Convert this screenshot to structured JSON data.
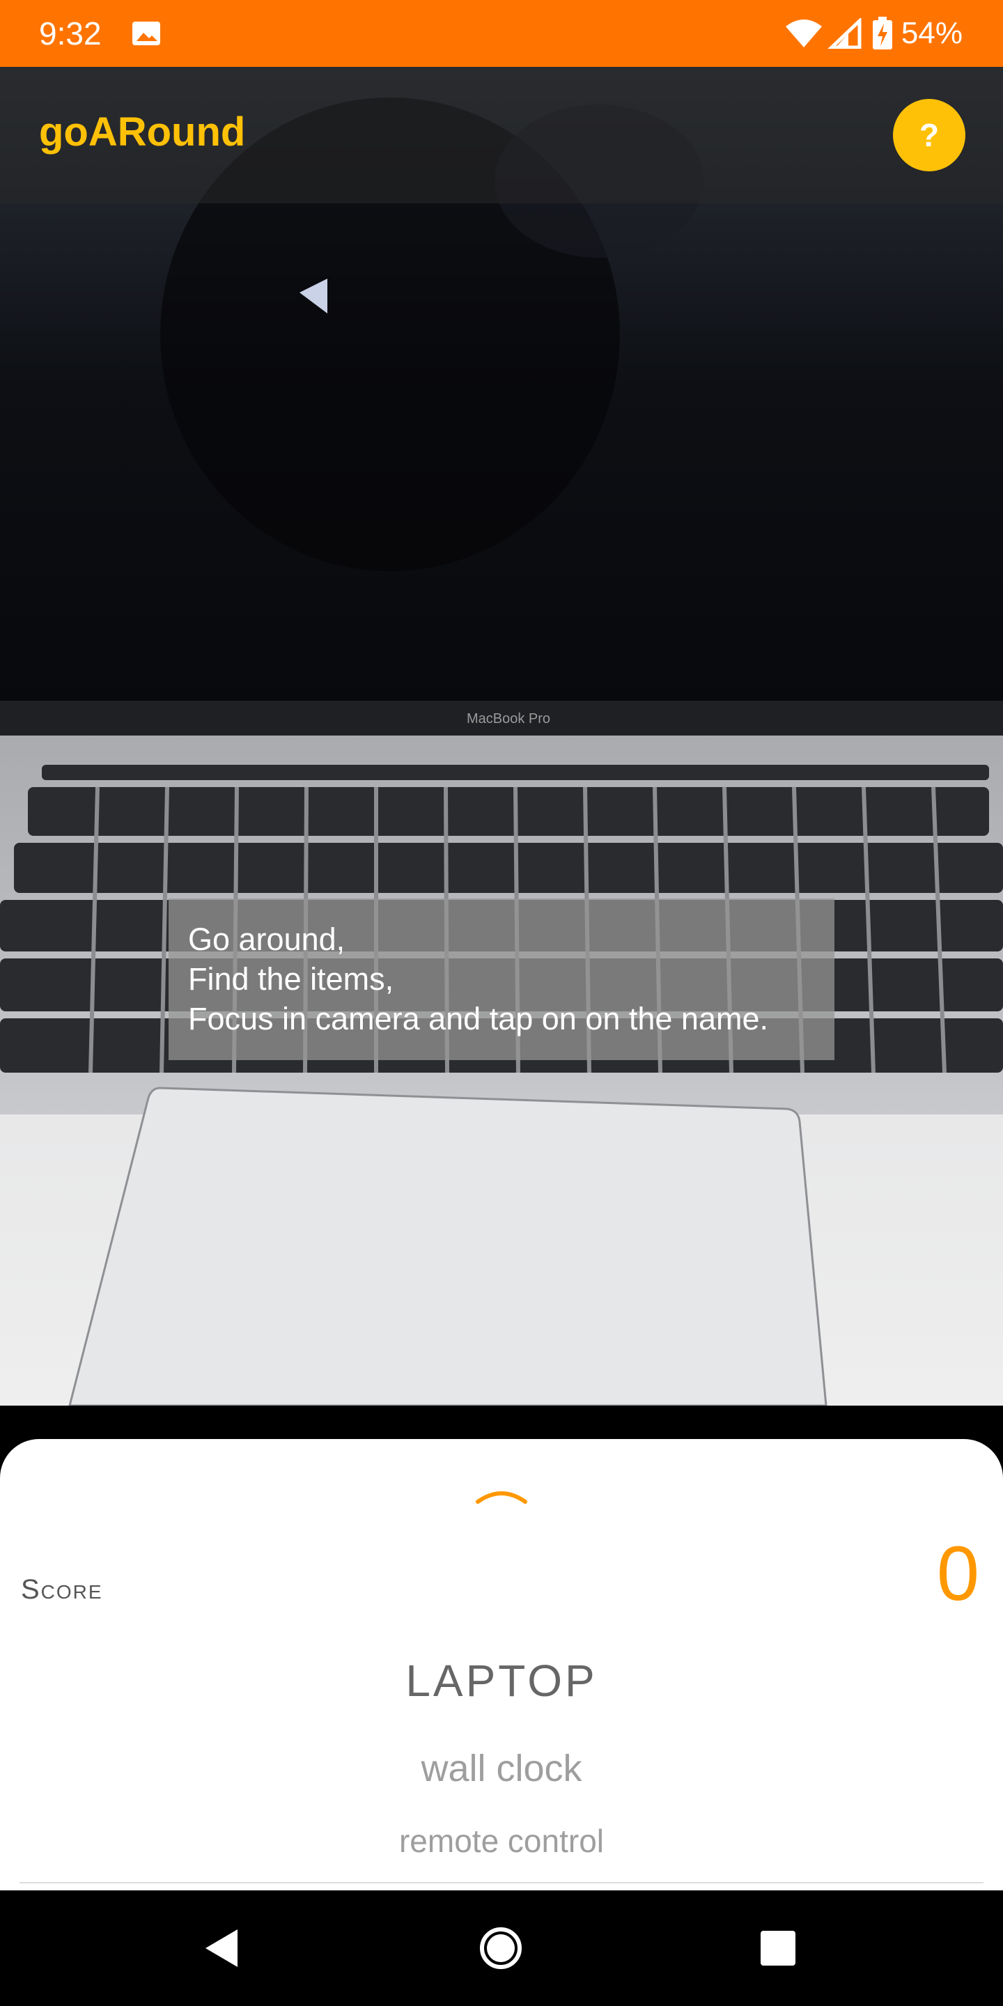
{
  "status_bar": {
    "time": "9:32",
    "battery": "54%",
    "background": "#FF7400"
  },
  "app_bar": {
    "title": "goARound",
    "help_label": "?",
    "accent": "#FFC107"
  },
  "camera": {
    "laptop_brand": "MacBook Pro"
  },
  "instructions": {
    "lines": [
      "Go around,",
      "Find the items,",
      "Focus in camera and tap on on the name."
    ]
  },
  "sheet": {
    "score_label": "Score",
    "score_value": "0",
    "items": [
      "LAPTOP",
      "wall clock",
      "remote control"
    ]
  },
  "nav": {
    "icons": [
      "back-icon",
      "home-icon",
      "recents-icon"
    ]
  }
}
